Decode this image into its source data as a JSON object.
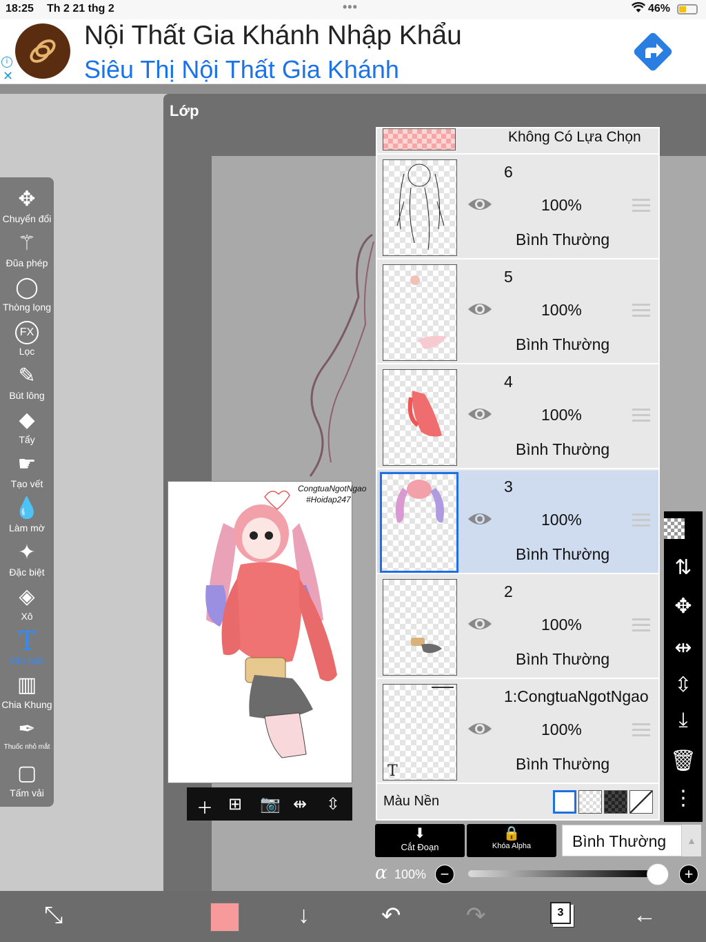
{
  "status_bar": {
    "time": "18:25",
    "date": "Th 2 21 thg 2",
    "battery": "46%"
  },
  "ad": {
    "title": "Nội Thất Gia Khánh Nhập Khẩu",
    "subtitle": "Siêu Thị Nội Thất Gia Khánh"
  },
  "panel": {
    "title": "Lớp"
  },
  "tools": [
    {
      "label": "Chuyển đổi"
    },
    {
      "label": "Đũa phép"
    },
    {
      "label": "Thòng lọng"
    },
    {
      "label": "Lọc"
    },
    {
      "label": "Bút lông"
    },
    {
      "label": "Tẩy"
    },
    {
      "label": "Tạo vết"
    },
    {
      "label": "Làm mờ"
    },
    {
      "label": "Đặc biệt"
    },
    {
      "label": "Xô"
    },
    {
      "label": "Văn bản"
    },
    {
      "label": "Chia Khung"
    },
    {
      "label": "Thuốc nhỏ mắt"
    },
    {
      "label": "Tấm vải"
    }
  ],
  "preview": {
    "caption_1": "CongtuaNgotNgao",
    "caption_2": "#Hoidap247"
  },
  "layers": {
    "no_selection": "Không Có Lựa Chọn",
    "items": [
      {
        "name": "6",
        "opacity": "100%",
        "blend": "Bình Thường"
      },
      {
        "name": "5",
        "opacity": "100%",
        "blend": "Bình Thường"
      },
      {
        "name": "4",
        "opacity": "100%",
        "blend": "Bình Thường"
      },
      {
        "name": "3",
        "opacity": "100%",
        "blend": "Bình Thường",
        "selected": true
      },
      {
        "name": "2",
        "opacity": "100%",
        "blend": "Bình Thường"
      },
      {
        "name": "1:CongtuaNgotNgao",
        "opacity": "100%",
        "blend": "Bình Thường"
      }
    ],
    "background_label": "Màu Nền"
  },
  "controls": {
    "clip_label": "Cắt Đoạn",
    "alpha_lock_label": "Khóa Alpha",
    "blend_mode": "Bình Thường",
    "alpha_symbol": "α",
    "opacity": "100%"
  },
  "bottom_nav": {
    "layer_count": "3",
    "color": "#f89a9c"
  }
}
